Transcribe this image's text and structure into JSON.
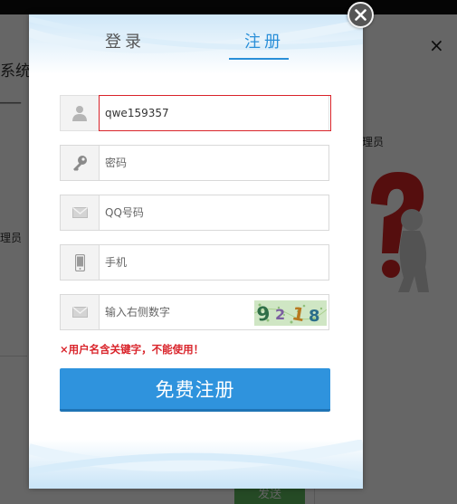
{
  "background_page": {
    "title_fragment": "系统",
    "admin_left": "理员",
    "admin_right": "理员",
    "close_glyph": "×",
    "send_button": "发送"
  },
  "modal": {
    "tabs": [
      {
        "label": "登录",
        "active": false
      },
      {
        "label": "注册",
        "active": true
      }
    ],
    "fields": {
      "username": {
        "value": "qwe159357",
        "icon": "user-icon"
      },
      "password": {
        "placeholder": "密码",
        "icon": "key-icon"
      },
      "qq": {
        "placeholder": "QQ号码",
        "icon": "envelope-icon"
      },
      "phone": {
        "placeholder": "手机",
        "icon": "mobile-phone-icon"
      },
      "captcha": {
        "placeholder": "输入右侧数字",
        "icon": "envelope-icon",
        "image_text": "9218"
      }
    },
    "error_message": "×用户名含关键字，不能使用！",
    "submit_label": "免费注册",
    "close_icon": "close-icon"
  },
  "colors": {
    "accent": "#2f93dd",
    "error": "#d9232a",
    "tab_active": "#2a8fd8",
    "send_green": "#5cb85c"
  }
}
